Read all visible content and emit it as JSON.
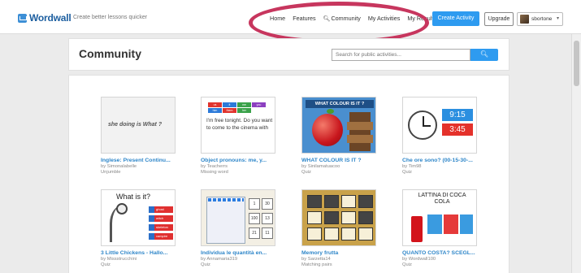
{
  "topbar": {
    "logo": "Wordwall",
    "tagline": "Create better lessons quicker",
    "nav": [
      "Home",
      "Features",
      "Community",
      "My Activities",
      "My Results"
    ],
    "create_label": "Create Activity",
    "upgrade_label": "Upgrade",
    "user_label": "sbortone"
  },
  "colors": {
    "accent": "#2e9bf0",
    "annotation": "#c7365e",
    "link": "#2e86c9"
  },
  "header": {
    "title": "Community",
    "search_placeholder": "Search for public activities..."
  },
  "cards": [
    {
      "title": "Inglese: Present Continu...",
      "author": "by Simonalabelle",
      "type": "Unjumble",
      "thumb_text": "she doing is What ?"
    },
    {
      "title": "Object pronouns: me, y...",
      "author": "by Teacherrs",
      "type": "Missing word",
      "thumb_text": "I'm free tonight. Do you want to come to the cinema with"
    },
    {
      "title": "WHAT COLOUR IS IT ?",
      "author": "by Sinilamatuacoo",
      "type": "Quiz",
      "thumb_text": "WHAT COLOUR IS IT ?"
    },
    {
      "title": "Che ore sono? (00-15-30-...",
      "author": "by Tim98",
      "type": "Quiz",
      "thumb_text": "9:15"
    },
    {
      "title": "3 Little Chickens - Hallo...",
      "author": "by Missstrucchini",
      "type": "Quiz",
      "thumb_text": "What is it?"
    },
    {
      "title": "Individua le quantità en...",
      "author": "by Annamaria319",
      "type": "Quiz",
      "thumb_text": ""
    },
    {
      "title": "Memory frutta",
      "author": "by Sarzetta14",
      "type": "Matching pairs",
      "thumb_text": ""
    },
    {
      "title": "QUANTO COSTA? SCEGL...",
      "author": "by Wordwall100",
      "type": "Quiz",
      "thumb_text": "LATTINA DI COCA COLA"
    }
  ],
  "thumb_details": {
    "pronoun_grid": [
      "us",
      "it",
      "me",
      "you",
      "him",
      "them",
      "her",
      ""
    ],
    "clock_time_2": "3:45",
    "skeleton_answers": [
      "ghost",
      "witch",
      "skeleton",
      "vampire"
    ],
    "number_cells": [
      "1",
      "30",
      "100",
      "13",
      "21",
      "11"
    ]
  }
}
